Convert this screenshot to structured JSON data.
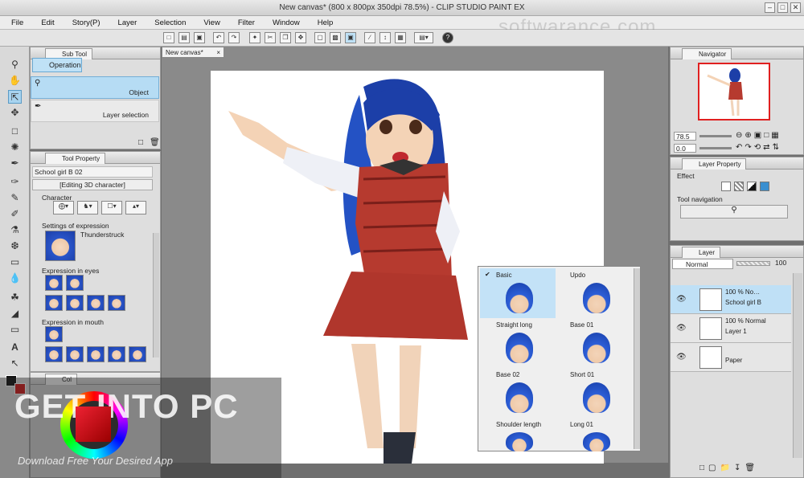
{
  "window": {
    "title": "New canvas* (800 x 800px 350dpi 78.5%) - CLIP STUDIO PAINT EX"
  },
  "window_controls": {
    "minimize": "–",
    "maximize": "□",
    "close": "✕"
  },
  "menu": [
    "File",
    "Edit",
    "Story(P)",
    "Layer",
    "Selection",
    "View",
    "Filter",
    "Window",
    "Help"
  ],
  "watermark": "softwarance.com",
  "sub_tool": {
    "tab": "Sub Tool",
    "group_button": "Operation",
    "items": [
      "Object",
      "Layer selection"
    ]
  },
  "tool_property": {
    "tab": "Tool Property",
    "object_name": "School girl B 02",
    "editing_label": "[Editing 3D character]",
    "character_label": "Character",
    "expression_settings_label": "Settings of expression",
    "expression_value": "Thunderstruck",
    "eyes_label": "Expression in eyes",
    "mouth_label": "Expression in mouth"
  },
  "color_panel": {
    "tab": "Col"
  },
  "canvas": {
    "tab": "New canvas*",
    "zoom": "78.5"
  },
  "hair_popup": {
    "items": [
      "Basic",
      "Updo",
      "Straight long",
      "Base 01",
      "Base 02",
      "Short 01",
      "Shoulder length",
      "Long 01"
    ],
    "selected": "Basic",
    "check": "✔"
  },
  "navigator": {
    "tab": "Navigator",
    "zoom": "78.5",
    "rotate": "0.0"
  },
  "layer_property": {
    "tab": "Layer Property",
    "effect_label": "Effect",
    "tool_nav_label": "Tool navigation"
  },
  "layer_panel": {
    "tab": "Layer",
    "blend_mode": "Normal",
    "opacity": "100",
    "layers": [
      {
        "line1": "100 % No…",
        "line2": "School girl B",
        "type": "3d",
        "selected": true
      },
      {
        "line1": "100 % Normal",
        "line2": "Layer 1",
        "type": "raster",
        "selected": false
      },
      {
        "line1": "",
        "line2": "Paper",
        "type": "paper",
        "selected": false
      }
    ]
  },
  "overlay": {
    "brand": "GET INTO PC",
    "tagline": "Download Free Your Desired App"
  },
  "colors": {
    "accent_blue": "#bfe1f6",
    "nav_frame": "#e02020",
    "hair": "#1c3fa8"
  }
}
